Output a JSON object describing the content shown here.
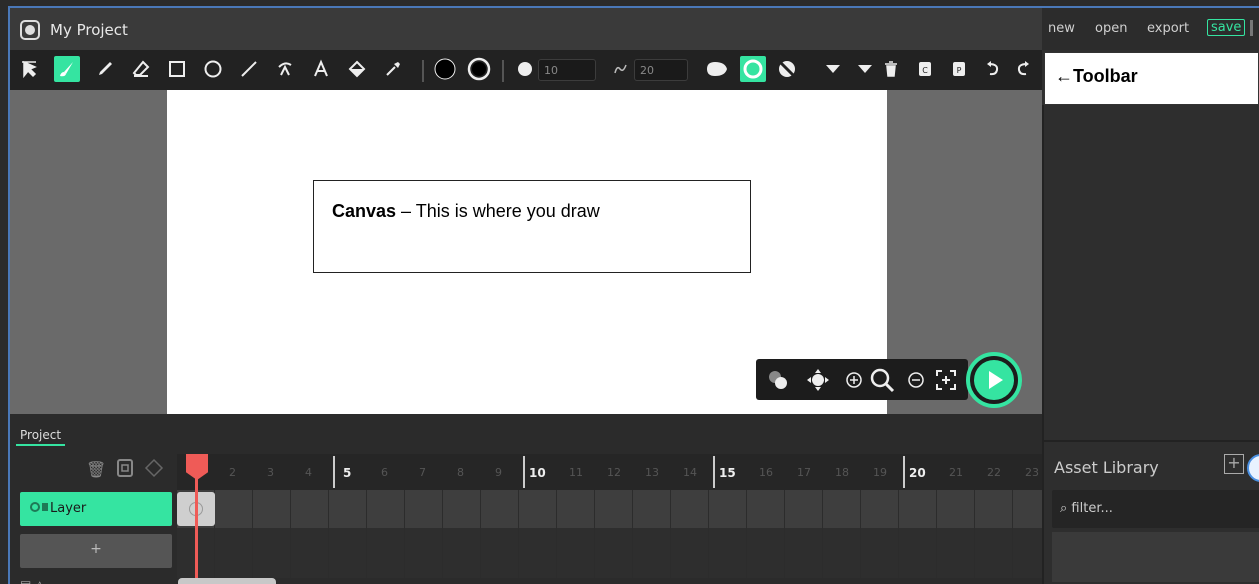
{
  "app": {
    "title": "My Project"
  },
  "menu": {
    "new": "new",
    "open": "open",
    "export": "export",
    "save": "save"
  },
  "toolbar": {
    "brush_size": "10",
    "smoothing": "20",
    "tools": [
      "select-icon",
      "brush-icon",
      "pencil-icon",
      "eraser-icon",
      "rectangle-icon",
      "ellipse-icon",
      "line-icon",
      "path-icon",
      "text-icon",
      "fill-icon",
      "eyedropper-icon"
    ]
  },
  "callouts": {
    "toolbar_arrow": "←",
    "toolbar_label": "Toolbar",
    "canvas_bold": "Canvas",
    "canvas_rest": " – This is where you draw"
  },
  "timeline": {
    "tab": "Project",
    "layer_name": "Layer",
    "add_label": "+",
    "frame_numbers": [
      "2",
      "3",
      "4",
      "5",
      "6",
      "7",
      "8",
      "9",
      "10",
      "11",
      "12",
      "13",
      "14",
      "15",
      "16",
      "17",
      "18",
      "19",
      "20",
      "21",
      "22",
      "23"
    ],
    "major_frames": [
      "5",
      "10",
      "15",
      "20"
    ]
  },
  "assets": {
    "title": "Asset Library",
    "filter_placeholder": "filter..."
  },
  "colors": {
    "accent": "#35e4a1",
    "playhead": "#ef5b57"
  }
}
